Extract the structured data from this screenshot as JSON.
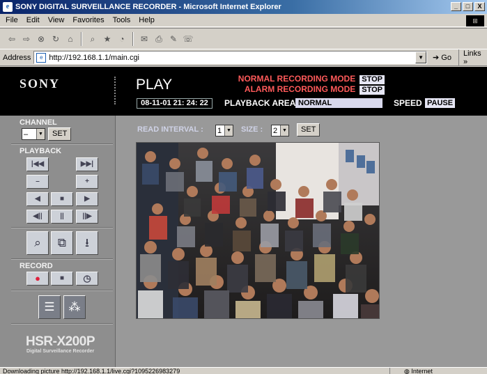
{
  "window": {
    "title": "SONY DIGITAL SURVEILLANCE RECORDER - Microsoft Internet Explorer",
    "min": "_",
    "max": "□",
    "close": "X"
  },
  "menu": [
    "File",
    "Edit",
    "View",
    "Favorites",
    "Tools",
    "Help"
  ],
  "address": {
    "label": "Address",
    "url": "http://192.168.1.1/main.cgi",
    "go": "Go",
    "links": "Links »"
  },
  "header": {
    "brand": "SONY",
    "mode": "PLAY",
    "normal_recording": "NORMAL RECORDING MODE",
    "normal_status": "STOP",
    "alarm_recording": "ALARM RECORDING MODE",
    "alarm_status": "STOP",
    "datetime": "08-11-01  21: 24: 22",
    "playback_area_label": "PLAYBACK AREA",
    "playback_area_value": "NORMAL",
    "speed_label": "SPEED",
    "speed_value": "PAUSE"
  },
  "sidebar": {
    "channel_label": "CHANNEL",
    "channel_value": "–",
    "set": "SET",
    "playback_label": "PLAYBACK",
    "playback_buttons": {
      "first": "|◀◀",
      "last": "▶▶|",
      "minus": "–",
      "plus": "+",
      "rewind": "◀",
      "stop": "■",
      "play": "▶",
      "step_back": "◀||",
      "pause": "||",
      "step_fwd": "||▶"
    },
    "tools": {
      "search": "⌕",
      "copy": "⧉",
      "download": "⭳"
    },
    "record_label": "RECORD",
    "record_buttons": {
      "rec": "●",
      "stop": "■",
      "timer": "◷"
    },
    "bottom": {
      "list": "☰",
      "alarm": "⁂"
    },
    "model": "HSR-X200P",
    "model_sub": "Digital Surveillance Recorder"
  },
  "viewer": {
    "read_interval_label": "READ INTERVAL :",
    "read_interval_value": "1",
    "size_label": "SIZE :",
    "size_value": "2",
    "set": "SET"
  },
  "status": {
    "text": "Downloading picture http://192.168.1.1/live.cgi?1095226983279",
    "zone": "Internet"
  },
  "colors": {
    "header_bg": "#000000",
    "alert_red": "#ff5a5a",
    "panel_gray": "#999999"
  }
}
